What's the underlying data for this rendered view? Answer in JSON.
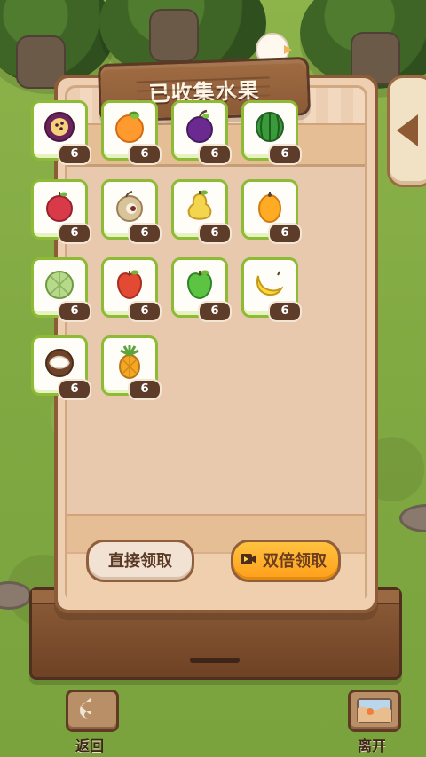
{
  "title": "已收集水果",
  "fruits": [
    {
      "name": "passionfruit-icon",
      "count": "6"
    },
    {
      "name": "orange-icon",
      "count": "6"
    },
    {
      "name": "plum-icon",
      "count": "6"
    },
    {
      "name": "watermelon-icon",
      "count": "6"
    },
    {
      "name": "cherry-tomato-icon",
      "count": "6"
    },
    {
      "name": "longan-icon",
      "count": "6"
    },
    {
      "name": "pear-icon",
      "count": "6"
    },
    {
      "name": "loquat-icon",
      "count": "6"
    },
    {
      "name": "cantaloupe-icon",
      "count": "6"
    },
    {
      "name": "apple-icon",
      "count": "6"
    },
    {
      "name": "green-apple-icon",
      "count": "6"
    },
    {
      "name": "banana-icon",
      "count": "6"
    },
    {
      "name": "coconut-icon",
      "count": "6"
    },
    {
      "name": "pineapple-icon",
      "count": "6"
    }
  ],
  "buttons": {
    "direct": "直接领取",
    "double": "双倍领取",
    "back": "返回",
    "leave": "离开"
  },
  "colors": {
    "panel_border": "#8c5c38",
    "card_border": "#8dbb35",
    "badge_bg": "#5d3d2a",
    "accent": "#ffb22e"
  }
}
